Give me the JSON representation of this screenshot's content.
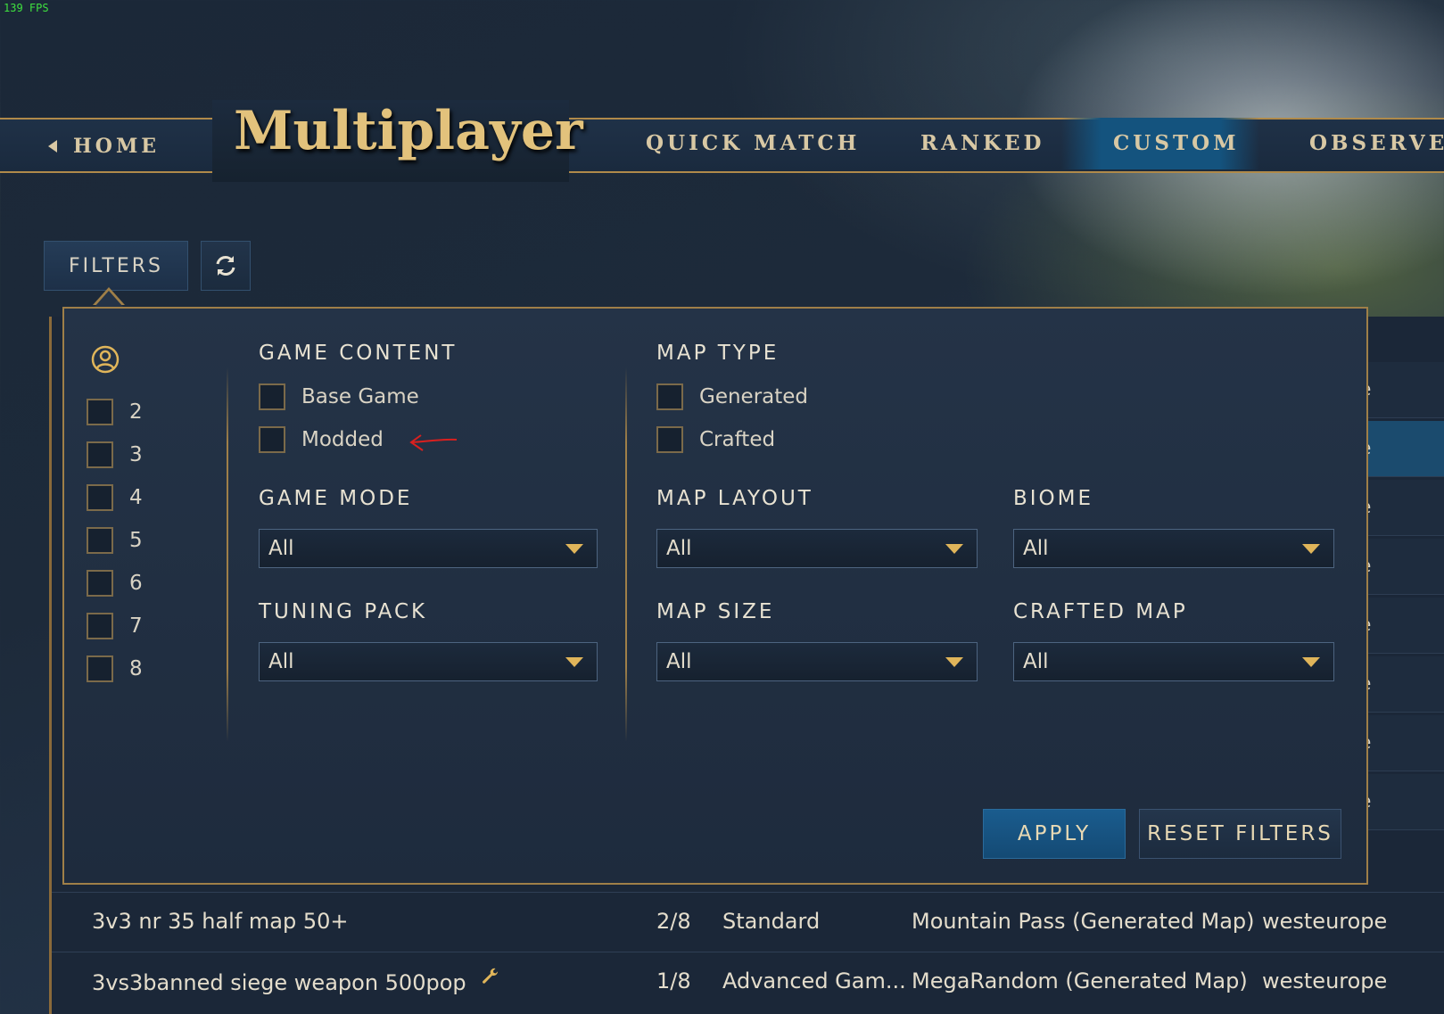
{
  "fps": "139 FPS",
  "nav": {
    "home": "HOME",
    "title": "Multiplayer",
    "tabs": [
      {
        "label": "QUICK MATCH"
      },
      {
        "label": "RANKED"
      },
      {
        "label": "CUSTOM",
        "active": true
      },
      {
        "label": "OBSERVE"
      }
    ]
  },
  "toolbar": {
    "filters_label": "FILTERS",
    "refresh_icon": "refresh-icon"
  },
  "filters": {
    "players": {
      "icon": "player-icon",
      "options": [
        "2",
        "3",
        "4",
        "5",
        "6",
        "7",
        "8"
      ]
    },
    "game_content": {
      "label": "GAME CONTENT",
      "options": [
        "Base Game",
        "Modded"
      ]
    },
    "map_type": {
      "label": "MAP TYPE",
      "options": [
        "Generated",
        "Crafted"
      ]
    },
    "game_mode": {
      "label": "GAME MODE",
      "value": "All"
    },
    "tuning_pack": {
      "label": "TUNING PACK",
      "value": "All"
    },
    "map_layout": {
      "label": "MAP LAYOUT",
      "value": "All"
    },
    "map_size": {
      "label": "MAP SIZE",
      "value": "All"
    },
    "biome": {
      "label": "BIOME",
      "value": "All"
    },
    "crafted_map": {
      "label": "CRAFTED MAP",
      "value": "All"
    },
    "apply_label": "APPLY",
    "reset_label": "RESET FILTERS"
  },
  "list": {
    "right_strip": [
      "e",
      "e",
      "e",
      "e",
      "e",
      "e",
      "e",
      "e"
    ],
    "rows": [
      {
        "name": "3v3 nr 35 half map 50+",
        "players": "2/8",
        "mode": "Standard",
        "map": "Mountain Pass (Generated Map)",
        "region": "westeurope",
        "modded": false
      },
      {
        "name": "3vs3banned siege weapon 500pop",
        "players": "1/8",
        "mode": "Advanced Gam...",
        "map": "MegaRandom (Generated Map)",
        "region": "westeurope",
        "modded": true
      }
    ]
  },
  "colors": {
    "gold": "#b08a4a",
    "accent_blue": "#14537e",
    "annotation": "#d9201f"
  }
}
